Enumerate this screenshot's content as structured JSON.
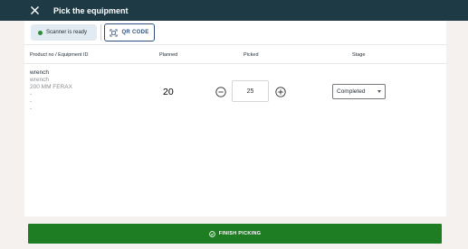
{
  "header": {
    "title": "Pick the equipment",
    "close_icon": "close-icon",
    "bg_color": "#1e3a45"
  },
  "toolbar": {
    "scanner_status": "Scanner is ready",
    "scanner_dot_color": "#2e8b3a",
    "qr_button_label": "QR CODE"
  },
  "table": {
    "columns": [
      "Product no / Equipment ID",
      "Planned",
      "Picked",
      "Stage"
    ],
    "rows": [
      {
        "name": "wrench",
        "subtitle": "wrench",
        "detail": "200 MM FERAX",
        "extra": [
          "-",
          "-",
          "-"
        ],
        "planned": "20",
        "picked": "25",
        "stage": "Completed"
      }
    ]
  },
  "footer": {
    "finish_label": "FINISH PICKING",
    "finish_color": "#1e7d22"
  }
}
